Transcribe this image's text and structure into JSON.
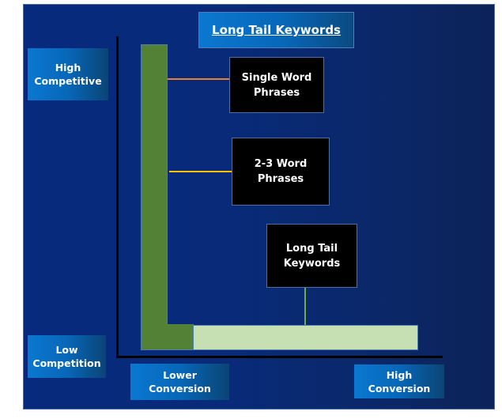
{
  "diagram": {
    "title": "Long Tail Keywords",
    "y_axis": {
      "top_label": "High\nCompetitive",
      "bottom_label": "Low\nCompetition"
    },
    "x_axis": {
      "left_label": "Lower\nConversion",
      "right_label": "High\nConversion"
    },
    "callouts": [
      {
        "label": "Single Word\nPhrases",
        "connector_color": "#ed7d31"
      },
      {
        "label": "2-3 Word\nPhrases",
        "connector_color": "#ffc000"
      },
      {
        "label": "Long Tail\nKeywords",
        "connector_color": "#70ad47"
      }
    ],
    "colors": {
      "background": "#072a7e",
      "label_box": "#0a78d0",
      "vertical_bar": "#538135",
      "horizontal_bar": "#c6e0b4",
      "callout_box": "#000000",
      "axis": "#000000"
    }
  }
}
